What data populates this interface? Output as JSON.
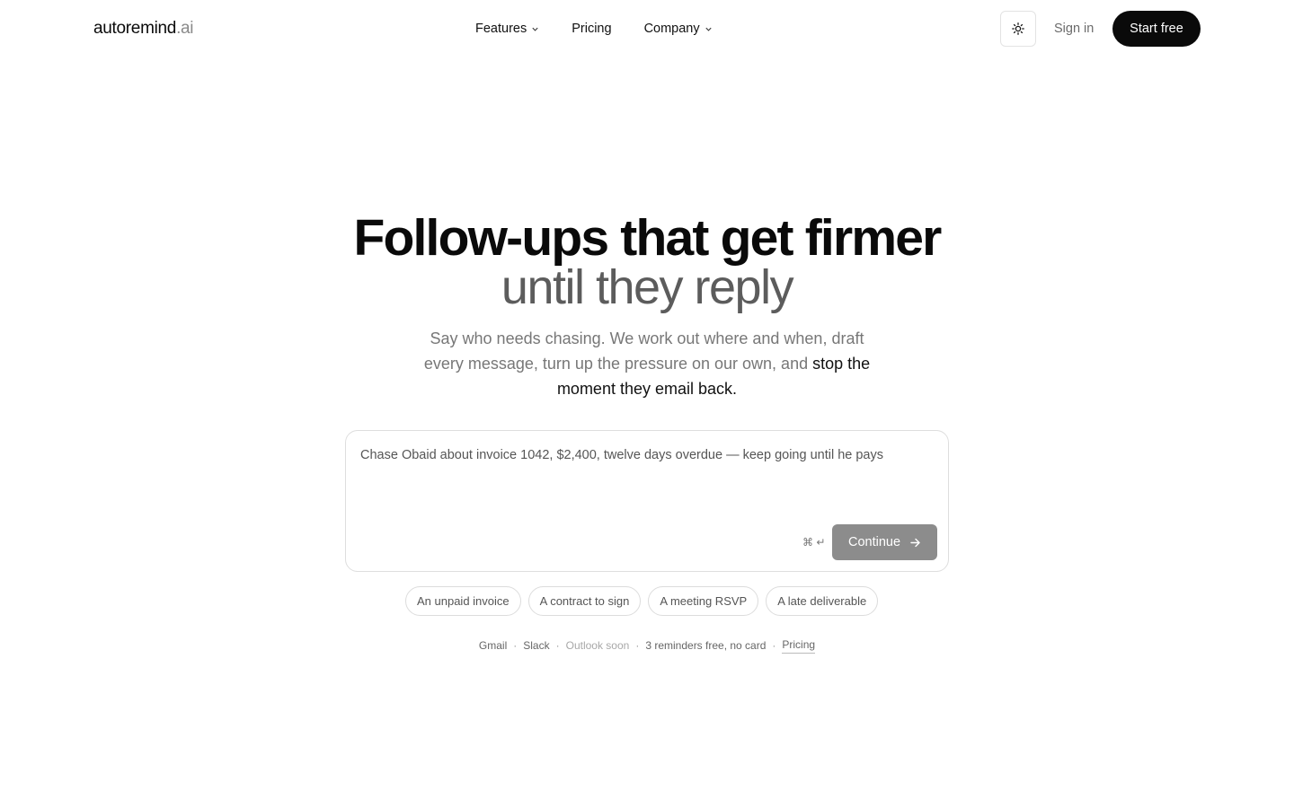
{
  "header": {
    "logo_main": "autoremind",
    "logo_tld": ".ai",
    "nav": {
      "features": "Features",
      "pricing": "Pricing",
      "company": "Company"
    },
    "theme_icon": "sun-icon",
    "sign_in": "Sign in",
    "start_free": "Start free"
  },
  "hero": {
    "title_line1": "Follow-ups that get firmer",
    "title_line2": "until they reply",
    "subtitle_part1": "Say who needs chasing. We work out where and when, draft every message, turn up the pressure on our own, and ",
    "subtitle_emphasis": "stop the moment they email back",
    "subtitle_end": "."
  },
  "composer": {
    "prompt_text": "Chase Obaid about invoice 1042, $2,400, twelve days overdue — keep going until he pays",
    "shortcut": "⌘ ↵",
    "continue_label": "Continue"
  },
  "chips": [
    "An unpaid invoice",
    "A contract to sign",
    "A meeting RSVP",
    "A late deliverable"
  ],
  "meta": {
    "gmail": "Gmail",
    "slack": "Slack",
    "outlook": "Outlook soon",
    "free": "3 reminders free, no card",
    "pricing": "Pricing"
  },
  "colors": {
    "primary_button": "#0a0a0a",
    "continue_disabled": "#8c8c8c"
  }
}
